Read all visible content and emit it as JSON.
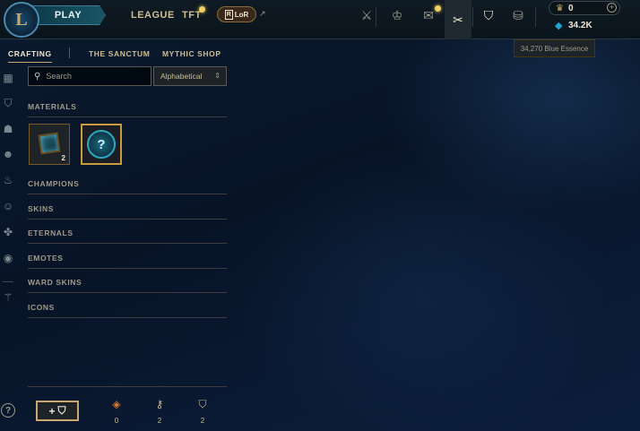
{
  "topbar": {
    "logo_letter": "L",
    "play_label": "PLAY",
    "nav": [
      "LEAGUE",
      "TFT"
    ],
    "lor_label": "LoR",
    "lor_icon": "R",
    "external_arrow": "↗",
    "icons": [
      {
        "name": "champion-icon",
        "glyph": "⚔"
      },
      {
        "name": "clash-icon",
        "glyph": "♔"
      },
      {
        "name": "loot-icon",
        "glyph": "✉"
      },
      {
        "name": "crafting-icon",
        "glyph": "✂"
      },
      {
        "name": "collection-icon",
        "glyph": "⛉"
      },
      {
        "name": "store-icon",
        "glyph": "⛁"
      }
    ],
    "rp_icon": "♛",
    "rp_value": "0",
    "plus": "+",
    "be_icon": "◆",
    "be_value": "34.2K",
    "tooltip": "34,270 Blue Essence",
    "accent_color": "#c8aa6e",
    "essence_color": "#1ea5d8"
  },
  "sidebar": {
    "icons": [
      {
        "name": "grid-icon",
        "glyph": "▦"
      },
      {
        "name": "champion-shield-icon",
        "glyph": "⛉"
      },
      {
        "name": "helmet-icon",
        "glyph": "☗"
      },
      {
        "name": "mask-icon",
        "glyph": "☻"
      },
      {
        "name": "flame-icon",
        "glyph": "♨"
      },
      {
        "name": "emote-face-icon",
        "glyph": "☺"
      },
      {
        "name": "ward-icon",
        "glyph": "✤"
      },
      {
        "name": "profile-icon",
        "glyph": "◉"
      },
      {
        "name": "sword-icon",
        "glyph": "⚚"
      }
    ],
    "help": "?"
  },
  "subnav": {
    "tabs": [
      "CRAFTING",
      "THE SANCTUM",
      "MYTHIC SHOP"
    ],
    "active": "CRAFTING"
  },
  "filters": {
    "search_placeholder": "Search",
    "search_icon": "⚲",
    "sort_value": "Alphabetical",
    "sort_chevron": "⌃⌄"
  },
  "categories": {
    "materials": "MATERIALS",
    "champions": "CHAMPIONS",
    "skins": "SKINS",
    "eternals": "ETERNALS",
    "emotes": "EMOTES",
    "ward_skins": "WARD SKINS",
    "icons": "ICONS"
  },
  "materials": [
    {
      "name": "hextech-chest",
      "count": "2"
    },
    {
      "name": "mystery-orb",
      "glyph": "?"
    }
  ],
  "bottom": {
    "add_plus": "+",
    "add_icon": "⛉",
    "inventory": [
      {
        "name": "orange-essence-icon",
        "glyph": "◈",
        "count": "0",
        "color": "#e07a2a"
      },
      {
        "name": "key-icon",
        "glyph": "⚷",
        "count": "2",
        "color": "#cdbe91"
      },
      {
        "name": "chest-icon",
        "glyph": "⛉",
        "count": "2",
        "color": "#cdbe91"
      }
    ]
  }
}
